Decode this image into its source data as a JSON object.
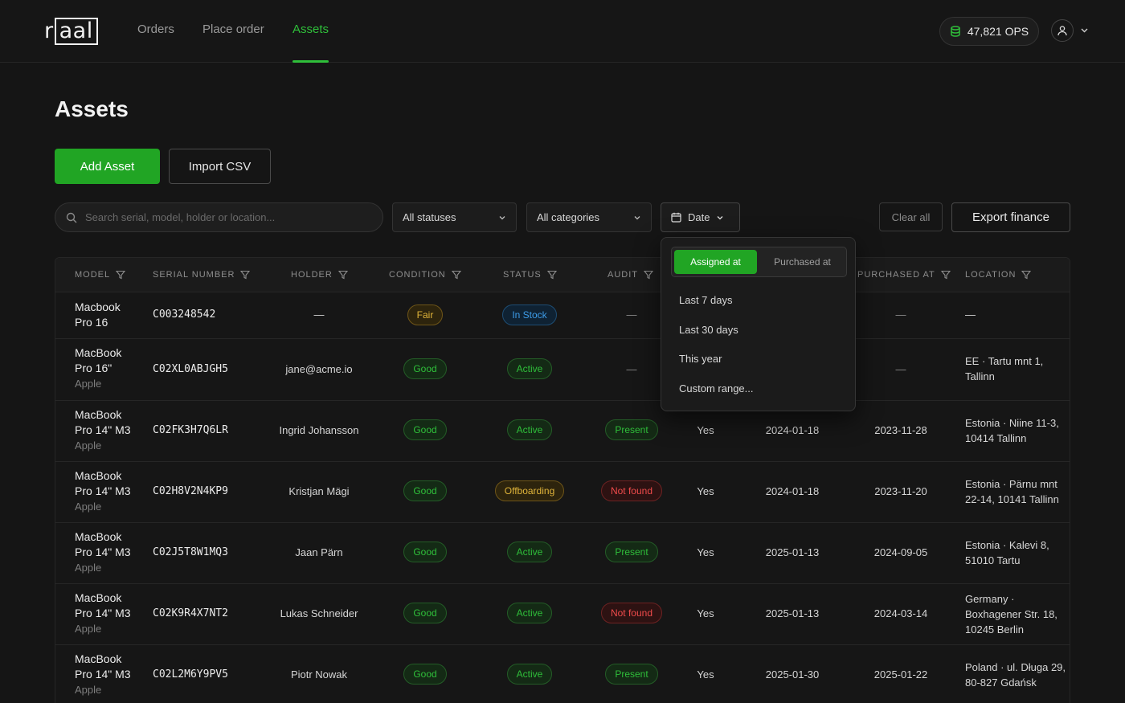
{
  "brand": {
    "logo_prefix": "r",
    "logo_boxed": "aal"
  },
  "nav": {
    "items": [
      {
        "label": "Orders",
        "active": false
      },
      {
        "label": "Place order",
        "active": false
      },
      {
        "label": "Assets",
        "active": true
      }
    ]
  },
  "account": {
    "ops_balance": "47,821 OPS"
  },
  "page": {
    "title": "Assets",
    "add_button": "Add Asset",
    "import_button": "Import CSV"
  },
  "filters": {
    "search_placeholder": "Search serial, model, holder or location...",
    "status_select": "All statuses",
    "category_select": "All categories",
    "date_button": "Date",
    "clear_button": "Clear all",
    "export_button": "Export finance"
  },
  "date_popover": {
    "tabs": [
      {
        "label": "Assigned at",
        "active": true
      },
      {
        "label": "Purchased at",
        "active": false
      }
    ],
    "options": [
      "Last 7 days",
      "Last 30 days",
      "This year",
      "Custom range..."
    ]
  },
  "table": {
    "columns": [
      "MODEL",
      "SERIAL NUMBER",
      "HOLDER",
      "CONDITION",
      "STATUS",
      "AUDIT",
      "PURCHASED AT",
      "LOCATION"
    ],
    "rows": [
      {
        "model_line1": "Macbook",
        "model_line2": "Pro 16",
        "brand": "",
        "serial": "C003248542",
        "holder": "—",
        "condition": "Fair",
        "status": "In Stock",
        "audit": "—",
        "flag": "",
        "assigned_at": "",
        "purchased_at": "—",
        "location": "—"
      },
      {
        "model_line1": "MacBook",
        "model_line2": "Pro 16\"",
        "brand": "Apple",
        "serial": "C02XL0ABJGH5",
        "holder": "jane@acme.io",
        "condition": "Good",
        "status": "Active",
        "audit": "—",
        "flag": "",
        "assigned_at": "",
        "purchased_at": "—",
        "location": "EE · Tartu mnt 1, Tallinn"
      },
      {
        "model_line1": "MacBook",
        "model_line2": "Pro 14\" M3",
        "brand": "Apple",
        "serial": "C02FK3H7Q6LR",
        "holder": "Ingrid Johansson",
        "condition": "Good",
        "status": "Active",
        "audit": "Present",
        "flag": "Yes",
        "assigned_at": "2024-01-18",
        "purchased_at": "2023-11-28",
        "location": "Estonia · Niine 11-3, 10414 Tallinn"
      },
      {
        "model_line1": "MacBook",
        "model_line2": "Pro 14\" M3",
        "brand": "Apple",
        "serial": "C02H8V2N4KP9",
        "holder": "Kristjan Mägi",
        "condition": "Good",
        "status": "Offboarding",
        "audit": "Not found",
        "flag": "Yes",
        "assigned_at": "2024-01-18",
        "purchased_at": "2023-11-20",
        "location": "Estonia · Pärnu mnt 22-14, 10141 Tallinn"
      },
      {
        "model_line1": "MacBook",
        "model_line2": "Pro 14\" M3",
        "brand": "Apple",
        "serial": "C02J5T8W1MQ3",
        "holder": "Jaan Pärn",
        "condition": "Good",
        "status": "Active",
        "audit": "Present",
        "flag": "Yes",
        "assigned_at": "2025-01-13",
        "purchased_at": "2024-09-05",
        "location": "Estonia · Kalevi 8, 51010 Tartu"
      },
      {
        "model_line1": "MacBook",
        "model_line2": "Pro 14\" M3",
        "brand": "Apple",
        "serial": "C02K9R4X7NT2",
        "holder": "Lukas Schneider",
        "condition": "Good",
        "status": "Active",
        "audit": "Not found",
        "flag": "Yes",
        "assigned_at": "2025-01-13",
        "purchased_at": "2024-03-14",
        "location": "Germany · Boxhagener Str. 18, 10245 Berlin"
      },
      {
        "model_line1": "MacBook",
        "model_line2": "Pro 14\" M3",
        "brand": "Apple",
        "serial": "C02L2M6Y9PV5",
        "holder": "Piotr Nowak",
        "condition": "Good",
        "status": "Active",
        "audit": "Present",
        "flag": "Yes",
        "assigned_at": "2025-01-30",
        "purchased_at": "2025-01-22",
        "location": "Poland · ul. Długa 29, 80-827 Gdańsk"
      }
    ]
  },
  "colors": {
    "accent": "#21a524",
    "background": "#151515"
  }
}
